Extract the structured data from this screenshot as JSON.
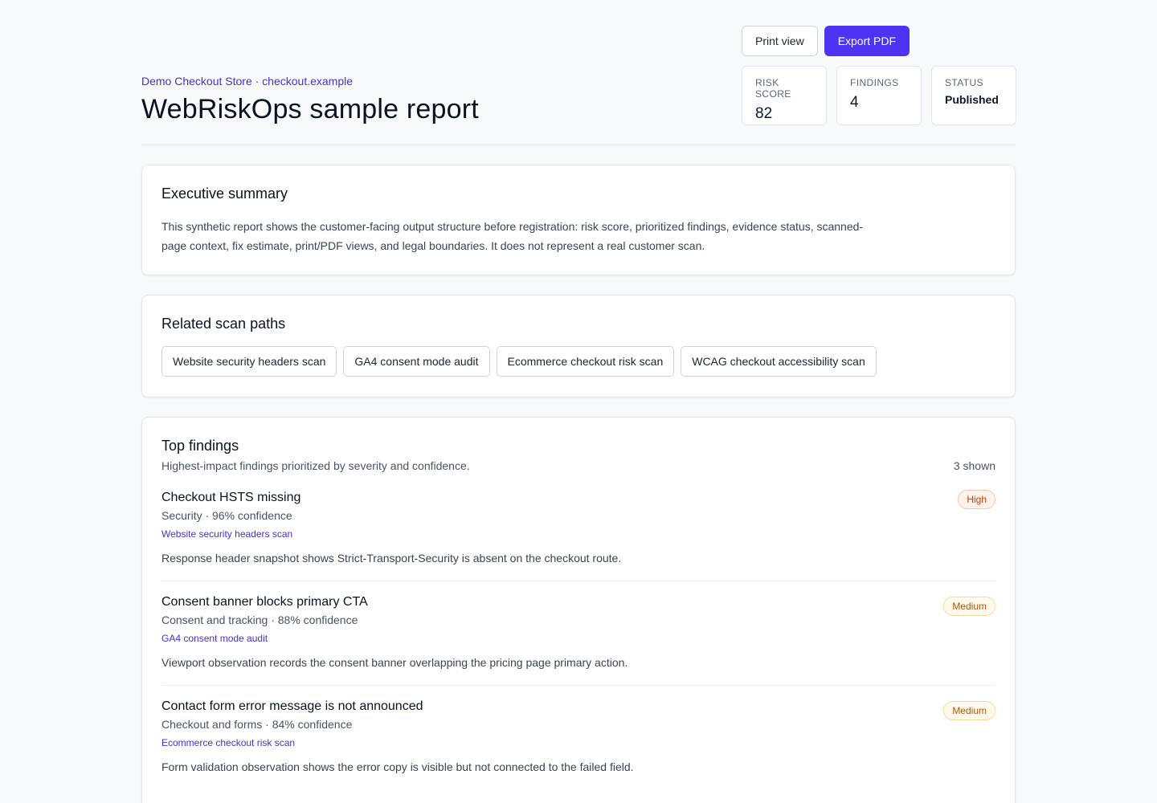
{
  "header": {
    "eyebrow": "Demo Checkout Store · checkout.example",
    "title": "WebRiskOps sample report",
    "actions": {
      "print_label": "Print view",
      "export_label": "Export PDF"
    },
    "stats": [
      {
        "label": "RISK SCORE",
        "value": "82"
      },
      {
        "label": "FINDINGS",
        "value": "4"
      },
      {
        "label": "STATUS",
        "value": "Published"
      }
    ]
  },
  "summary": {
    "title": "Executive summary",
    "text": "This synthetic report shows the customer-facing output structure before registration: risk score, prioritized findings, evidence status, scanned-page context, fix estimate, print/PDF views, and legal boundaries. It does not represent a real customer scan."
  },
  "paths": {
    "title": "Related scan paths",
    "items": [
      "Website security headers scan",
      "GA4 consent mode audit",
      "Ecommerce checkout risk scan",
      "WCAG checkout accessibility scan"
    ]
  },
  "findings": {
    "title": "Top findings",
    "subtitle": "Highest-impact findings prioritized by severity and confidence.",
    "count": "3 shown",
    "items": [
      {
        "title": "Checkout HSTS missing",
        "meta": "Security · 96% confidence",
        "link": "Website security headers scan",
        "text": "Response header snapshot shows Strict-Transport-Security is absent on the checkout route.",
        "severity": "High"
      },
      {
        "title": "Consent banner blocks primary CTA",
        "meta": "Consent and tracking · 88% confidence",
        "link": "GA4 consent mode audit",
        "text": "Viewport observation records the consent banner overlapping the pricing page primary action.",
        "severity": "Medium"
      },
      {
        "title": "Contact form error message is not announced",
        "meta": "Checkout and forms · 84% confidence",
        "link": "Ecommerce checkout risk scan",
        "text": "Form validation observation shows the error copy is visible but not connected to the failed field.",
        "severity": "Medium"
      }
    ]
  },
  "colors": {
    "accent": "#4f33f5",
    "link": "#4a2fd6",
    "high": "#c2410c",
    "medium": "#b45309"
  }
}
